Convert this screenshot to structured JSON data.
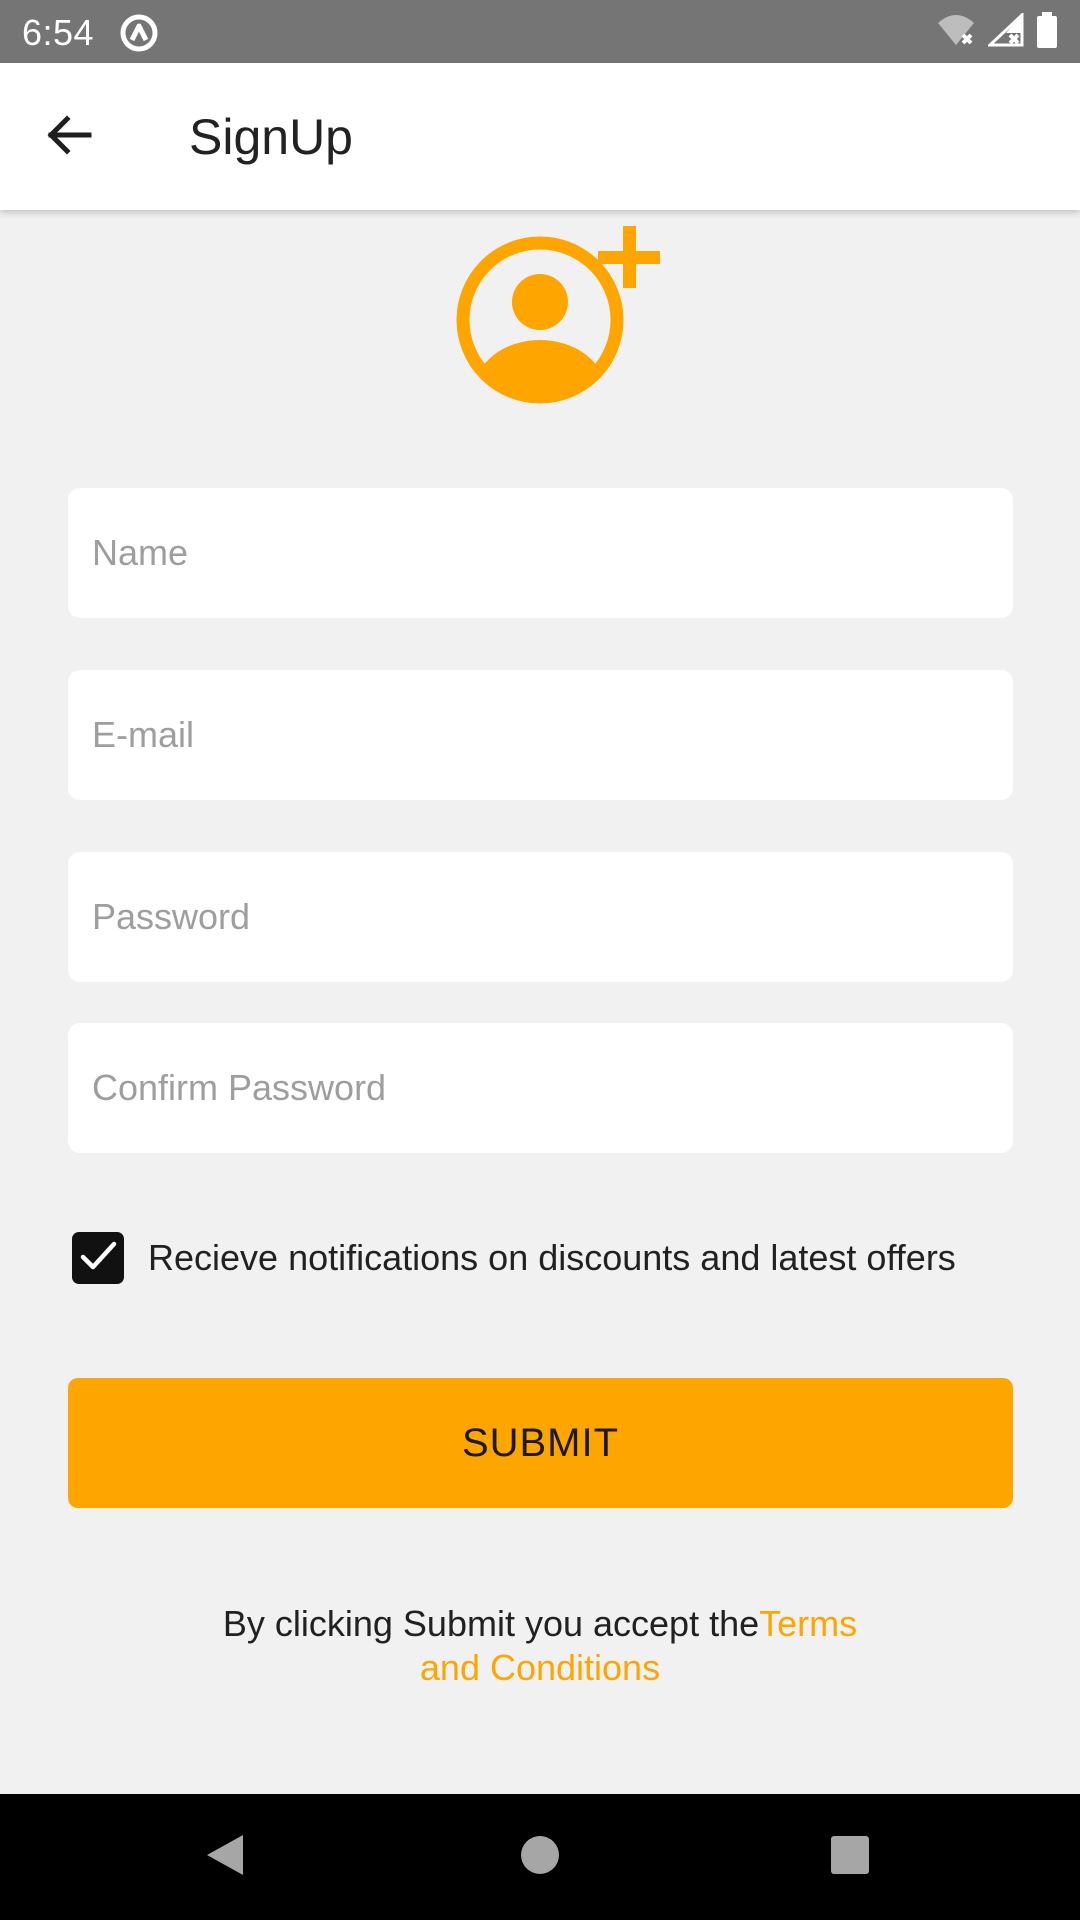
{
  "status_bar": {
    "time": "6:54"
  },
  "app_bar": {
    "title": "SignUp"
  },
  "form": {
    "name_placeholder": "Name",
    "email_placeholder": "E-mail",
    "password_placeholder": "Password",
    "confirm_password_placeholder": "Confirm Password",
    "notifications_label": "Recieve notifications on discounts and latest offers",
    "notifications_checked": true,
    "submit_label": "SUBMIT"
  },
  "terms": {
    "prefix": "By clicking Submit you accept the",
    "link_part1": "Terms",
    "link_part2": "and Conditions"
  },
  "colors": {
    "accent": "#ffa500",
    "status_bar": "#757575",
    "background": "#f1f1f1"
  },
  "icons": {
    "back": "arrow-left-icon",
    "avatar": "add-user-icon",
    "nav_back": "triangle-back-icon",
    "nav_home": "circle-home-icon",
    "nav_recents": "square-recents-icon"
  }
}
